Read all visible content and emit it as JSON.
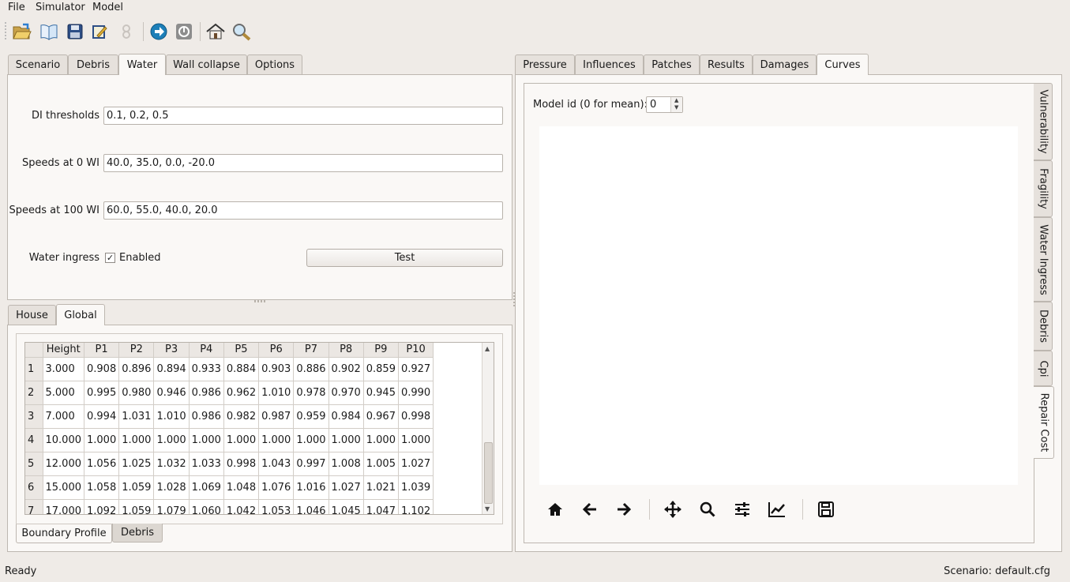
{
  "menubar": {
    "items": [
      "File",
      "Simulator",
      "Model"
    ]
  },
  "toolbar": {
    "icons": [
      "open-folder-icon",
      "book-icon",
      "save-disk-icon",
      "edit-document-icon",
      "pin-icon",
      "run-arrow-icon",
      "stop-icon",
      "home-icon",
      "magnifier-icon"
    ]
  },
  "left_tabs": {
    "items": [
      "Scenario",
      "Debris",
      "Water",
      "Wall collapse",
      "Options"
    ],
    "active": "Water"
  },
  "water": {
    "di_thresholds_label": "DI thresholds",
    "di_thresholds_value": "0.1, 0.2, 0.5",
    "speeds0_label": "Speeds at 0 WI",
    "speeds0_value": "40.0, 35.0, 0.0, -20.0",
    "speeds100_label": "Speeds at 100 WI",
    "speeds100_value": "60.0, 55.0, 40.0, 20.0",
    "ingress_label": "Water ingress",
    "enabled_label": "Enabled",
    "enabled_checked": true,
    "test_button": "Test"
  },
  "lower_tabs": {
    "items": [
      "House",
      "Global"
    ],
    "active": "Global"
  },
  "table": {
    "columns": [
      "Height",
      "P1",
      "P2",
      "P3",
      "P4",
      "P5",
      "P6",
      "P7",
      "P8",
      "P9",
      "P10"
    ],
    "rows": [
      [
        "1",
        "3.000",
        "0.908",
        "0.896",
        "0.894",
        "0.933",
        "0.884",
        "0.903",
        "0.886",
        "0.902",
        "0.859",
        "0.927"
      ],
      [
        "2",
        "5.000",
        "0.995",
        "0.980",
        "0.946",
        "0.986",
        "0.962",
        "1.010",
        "0.978",
        "0.970",
        "0.945",
        "0.990"
      ],
      [
        "3",
        "7.000",
        "0.994",
        "1.031",
        "1.010",
        "0.986",
        "0.982",
        "0.987",
        "0.959",
        "0.984",
        "0.967",
        "0.998"
      ],
      [
        "4",
        "10.000",
        "1.000",
        "1.000",
        "1.000",
        "1.000",
        "1.000",
        "1.000",
        "1.000",
        "1.000",
        "1.000",
        "1.000"
      ],
      [
        "5",
        "12.000",
        "1.056",
        "1.025",
        "1.032",
        "1.033",
        "0.998",
        "1.043",
        "0.997",
        "1.008",
        "1.005",
        "1.027"
      ],
      [
        "6",
        "15.000",
        "1.058",
        "1.059",
        "1.028",
        "1.069",
        "1.048",
        "1.076",
        "1.016",
        "1.027",
        "1.021",
        "1.039"
      ],
      [
        "7",
        "17.000",
        "1.092",
        "1.059",
        "1.079",
        "1.060",
        "1.042",
        "1.053",
        "1.046",
        "1.045",
        "1.047",
        "1.102"
      ]
    ]
  },
  "bottom_tabs": {
    "items": [
      "Boundary Profile",
      "Debris"
    ],
    "active": "Boundary Profile"
  },
  "right_tabs": {
    "items": [
      "Pressure",
      "Influences",
      "Patches",
      "Results",
      "Damages",
      "Curves"
    ],
    "active": "Curves"
  },
  "curves": {
    "model_id_label": "Model id (0 for mean):",
    "model_id_value": "0"
  },
  "vertical_tabs": {
    "items": [
      "Vulnerability",
      "Fragility",
      "Water Ingress",
      "Debris",
      "Cpi",
      "Repair Cost"
    ],
    "active": "Repair Cost"
  },
  "mpl_toolbar": {
    "icons": [
      "home-icon",
      "back-arrow-icon",
      "forward-arrow-icon",
      "pan-move-icon",
      "zoom-icon",
      "subplots-config-icon",
      "edit-curves-icon",
      "save-icon"
    ]
  },
  "status": {
    "left": "Ready",
    "right": "Scenario: default.cfg"
  }
}
